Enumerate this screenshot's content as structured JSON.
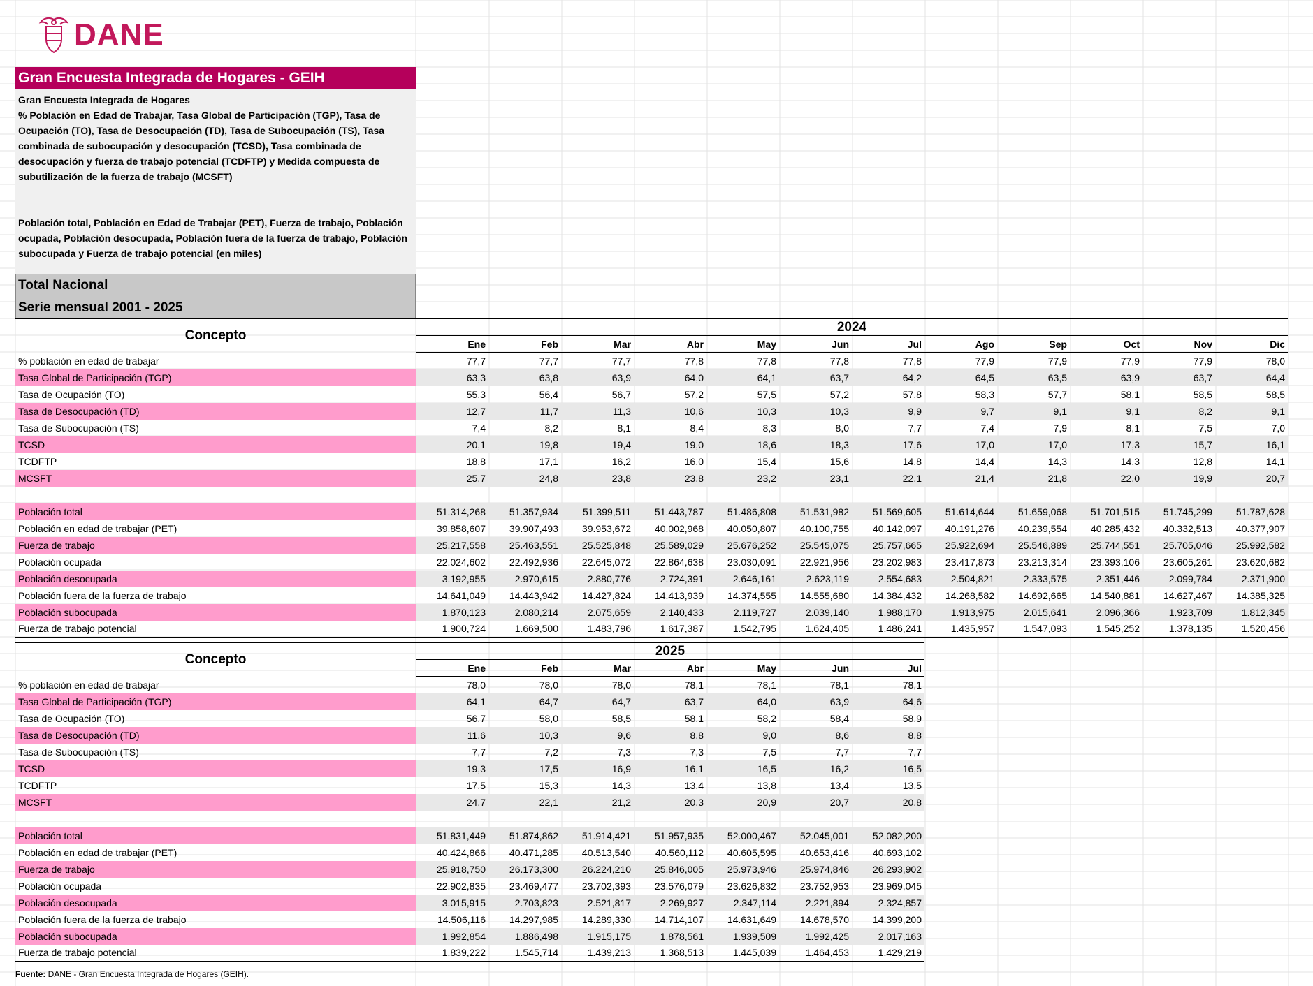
{
  "logo": {
    "text": "DANE",
    "icon": "coat-of-arms-icon",
    "color": "#c2185b"
  },
  "title": "Gran Encuesta Integrada de Hogares - GEIH",
  "description": [
    "Gran Encuesta Integrada de Hogares",
    "% Población en Edad de Trabajar, Tasa Global de Participación (TGP), Tasa de Ocupación (TO), Tasa de Desocupación (TD), Tasa de Subocupación (TS), Tasa combinada de subocupación y desocupación (TCSD), Tasa combinada de desocupación y fuerza de trabajo potencial (TCDFTP) y Medida compuesta de subutilización de la fuerza de trabajo (MCSFT)",
    "Población total, Población en Edad de Trabajar (PET), Fuerza de trabajo, Población ocupada, Población desocupada, Población fuera de la fuerza de trabajo, Población subocupada y Fuerza de trabajo potencial (en miles)"
  ],
  "region": "Total Nacional",
  "series": "Serie mensual 2001 - 2025",
  "concept_label": "Concepto",
  "colors": {
    "title_bg": "#b5005b",
    "pink_label": "#ff9ccc",
    "pink_value_bg": "#e8e8e8",
    "region_bg": "#c8c8c8",
    "desc_bg": "#f0f0f0"
  },
  "tables": [
    {
      "year": "2024",
      "months": [
        "Ene",
        "Feb",
        "Mar",
        "Abr",
        "May",
        "Jun",
        "Jul",
        "Ago",
        "Sep",
        "Oct",
        "Nov",
        "Dic"
      ],
      "rates": [
        {
          "label": "% población en edad de trabajar",
          "pink": false,
          "values": [
            "77,7",
            "77,7",
            "77,7",
            "77,8",
            "77,8",
            "77,8",
            "77,8",
            "77,9",
            "77,9",
            "77,9",
            "77,9",
            "78,0"
          ]
        },
        {
          "label": "Tasa Global de Participación (TGP)",
          "pink": true,
          "values": [
            "63,3",
            "63,8",
            "63,9",
            "64,0",
            "64,1",
            "63,7",
            "64,2",
            "64,5",
            "63,5",
            "63,9",
            "63,7",
            "64,4"
          ]
        },
        {
          "label": "Tasa de Ocupación (TO)",
          "pink": false,
          "values": [
            "55,3",
            "56,4",
            "56,7",
            "57,2",
            "57,5",
            "57,2",
            "57,8",
            "58,3",
            "57,7",
            "58,1",
            "58,5",
            "58,5"
          ]
        },
        {
          "label": "Tasa de Desocupación (TD)",
          "pink": true,
          "values": [
            "12,7",
            "11,7",
            "11,3",
            "10,6",
            "10,3",
            "10,3",
            "9,9",
            "9,7",
            "9,1",
            "9,1",
            "8,2",
            "9,1"
          ]
        },
        {
          "label": "Tasa de Subocupación (TS)",
          "pink": false,
          "values": [
            "7,4",
            "8,2",
            "8,1",
            "8,4",
            "8,3",
            "8,0",
            "7,7",
            "7,4",
            "7,9",
            "8,1",
            "7,5",
            "7,0"
          ]
        },
        {
          "label": "TCSD",
          "pink": true,
          "values": [
            "20,1",
            "19,8",
            "19,4",
            "19,0",
            "18,6",
            "18,3",
            "17,6",
            "17,0",
            "17,0",
            "17,3",
            "15,7",
            "16,1"
          ]
        },
        {
          "label": "TCDFTP",
          "pink": false,
          "values": [
            "18,8",
            "17,1",
            "16,2",
            "16,0",
            "15,4",
            "15,6",
            "14,8",
            "14,4",
            "14,3",
            "14,3",
            "12,8",
            "14,1"
          ]
        },
        {
          "label": "MCSFT",
          "pink": true,
          "values": [
            "25,7",
            "24,8",
            "23,8",
            "23,8",
            "23,2",
            "23,1",
            "22,1",
            "21,4",
            "21,8",
            "22,0",
            "19,9",
            "20,7"
          ]
        }
      ],
      "populations": [
        {
          "label": "Población total",
          "pink": true,
          "values": [
            "51.314,268",
            "51.357,934",
            "51.399,511",
            "51.443,787",
            "51.486,808",
            "51.531,982",
            "51.569,605",
            "51.614,644",
            "51.659,068",
            "51.701,515",
            "51.745,299",
            "51.787,628"
          ]
        },
        {
          "label": "Población en edad de trabajar (PET)",
          "pink": false,
          "values": [
            "39.858,607",
            "39.907,493",
            "39.953,672",
            "40.002,968",
            "40.050,807",
            "40.100,755",
            "40.142,097",
            "40.191,276",
            "40.239,554",
            "40.285,432",
            "40.332,513",
            "40.377,907"
          ]
        },
        {
          "label": "Fuerza de trabajo",
          "pink": true,
          "values": [
            "25.217,558",
            "25.463,551",
            "25.525,848",
            "25.589,029",
            "25.676,252",
            "25.545,075",
            "25.757,665",
            "25.922,694",
            "25.546,889",
            "25.744,551",
            "25.705,046",
            "25.992,582"
          ]
        },
        {
          "label": "Población ocupada",
          "pink": false,
          "values": [
            "22.024,602",
            "22.492,936",
            "22.645,072",
            "22.864,638",
            "23.030,091",
            "22.921,956",
            "23.202,983",
            "23.417,873",
            "23.213,314",
            "23.393,106",
            "23.605,261",
            "23.620,682"
          ]
        },
        {
          "label": "Población desocupada",
          "pink": true,
          "values": [
            "3.192,955",
            "2.970,615",
            "2.880,776",
            "2.724,391",
            "2.646,161",
            "2.623,119",
            "2.554,683",
            "2.504,821",
            "2.333,575",
            "2.351,446",
            "2.099,784",
            "2.371,900"
          ]
        },
        {
          "label": "Población fuera de la fuerza de trabajo",
          "pink": false,
          "values": [
            "14.641,049",
            "14.443,942",
            "14.427,824",
            "14.413,939",
            "14.374,555",
            "14.555,680",
            "14.384,432",
            "14.268,582",
            "14.692,665",
            "14.540,881",
            "14.627,467",
            "14.385,325"
          ]
        },
        {
          "label": "Población subocupada",
          "pink": true,
          "values": [
            "1.870,123",
            "2.080,214",
            "2.075,659",
            "2.140,433",
            "2.119,727",
            "2.039,140",
            "1.988,170",
            "1.913,975",
            "2.015,641",
            "2.096,366",
            "1.923,709",
            "1.812,345"
          ]
        },
        {
          "label": "Fuerza de trabajo potencial",
          "pink": false,
          "values": [
            "1.900,724",
            "1.669,500",
            "1.483,796",
            "1.617,387",
            "1.542,795",
            "1.624,405",
            "1.486,241",
            "1.435,957",
            "1.547,093",
            "1.545,252",
            "1.378,135",
            "1.520,456"
          ]
        }
      ]
    },
    {
      "year": "2025",
      "months": [
        "Ene",
        "Feb",
        "Mar",
        "Abr",
        "May",
        "Jun",
        "Jul"
      ],
      "rates": [
        {
          "label": "% población en edad de trabajar",
          "pink": false,
          "values": [
            "78,0",
            "78,0",
            "78,0",
            "78,1",
            "78,1",
            "78,1",
            "78,1"
          ]
        },
        {
          "label": "Tasa Global de Participación (TGP)",
          "pink": true,
          "values": [
            "64,1",
            "64,7",
            "64,7",
            "63,7",
            "64,0",
            "63,9",
            "64,6"
          ]
        },
        {
          "label": "Tasa de Ocupación (TO)",
          "pink": false,
          "values": [
            "56,7",
            "58,0",
            "58,5",
            "58,1",
            "58,2",
            "58,4",
            "58,9"
          ]
        },
        {
          "label": "Tasa de Desocupación (TD)",
          "pink": true,
          "values": [
            "11,6",
            "10,3",
            "9,6",
            "8,8",
            "9,0",
            "8,6",
            "8,8"
          ]
        },
        {
          "label": "Tasa de Subocupación (TS)",
          "pink": false,
          "values": [
            "7,7",
            "7,2",
            "7,3",
            "7,3",
            "7,5",
            "7,7",
            "7,7"
          ]
        },
        {
          "label": "TCSD",
          "pink": true,
          "values": [
            "19,3",
            "17,5",
            "16,9",
            "16,1",
            "16,5",
            "16,2",
            "16,5"
          ]
        },
        {
          "label": "TCDFTP",
          "pink": false,
          "values": [
            "17,5",
            "15,3",
            "14,3",
            "13,4",
            "13,8",
            "13,4",
            "13,5"
          ]
        },
        {
          "label": "MCSFT",
          "pink": true,
          "values": [
            "24,7",
            "22,1",
            "21,2",
            "20,3",
            "20,9",
            "20,7",
            "20,8"
          ]
        }
      ],
      "populations": [
        {
          "label": "Población total",
          "pink": true,
          "values": [
            "51.831,449",
            "51.874,862",
            "51.914,421",
            "51.957,935",
            "52.000,467",
            "52.045,001",
            "52.082,200"
          ]
        },
        {
          "label": "Población en edad de trabajar (PET)",
          "pink": false,
          "values": [
            "40.424,866",
            "40.471,285",
            "40.513,540",
            "40.560,112",
            "40.605,595",
            "40.653,416",
            "40.693,102"
          ]
        },
        {
          "label": "Fuerza de trabajo",
          "pink": true,
          "values": [
            "25.918,750",
            "26.173,300",
            "26.224,210",
            "25.846,005",
            "25.973,946",
            "25.974,846",
            "26.293,902"
          ]
        },
        {
          "label": "Población ocupada",
          "pink": false,
          "values": [
            "22.902,835",
            "23.469,477",
            "23.702,393",
            "23.576,079",
            "23.626,832",
            "23.752,953",
            "23.969,045"
          ]
        },
        {
          "label": "Población desocupada",
          "pink": true,
          "values": [
            "3.015,915",
            "2.703,823",
            "2.521,817",
            "2.269,927",
            "2.347,114",
            "2.221,894",
            "2.324,857"
          ]
        },
        {
          "label": "Población fuera de la fuerza de trabajo",
          "pink": false,
          "values": [
            "14.506,116",
            "14.297,985",
            "14.289,330",
            "14.714,107",
            "14.631,649",
            "14.678,570",
            "14.399,200"
          ]
        },
        {
          "label": "Población subocupada",
          "pink": true,
          "values": [
            "1.992,854",
            "1.886,498",
            "1.915,175",
            "1.878,561",
            "1.939,509",
            "1.992,425",
            "2.017,163"
          ]
        },
        {
          "label": "Fuerza de trabajo potencial",
          "pink": false,
          "values": [
            "1.839,222",
            "1.545,714",
            "1.439,213",
            "1.368,513",
            "1.445,039",
            "1.464,453",
            "1.429,219"
          ]
        }
      ]
    }
  ],
  "source": {
    "label": "Fuente:",
    "text": " DANE - Gran Encuesta Integrada de Hogares (GEIH)."
  }
}
